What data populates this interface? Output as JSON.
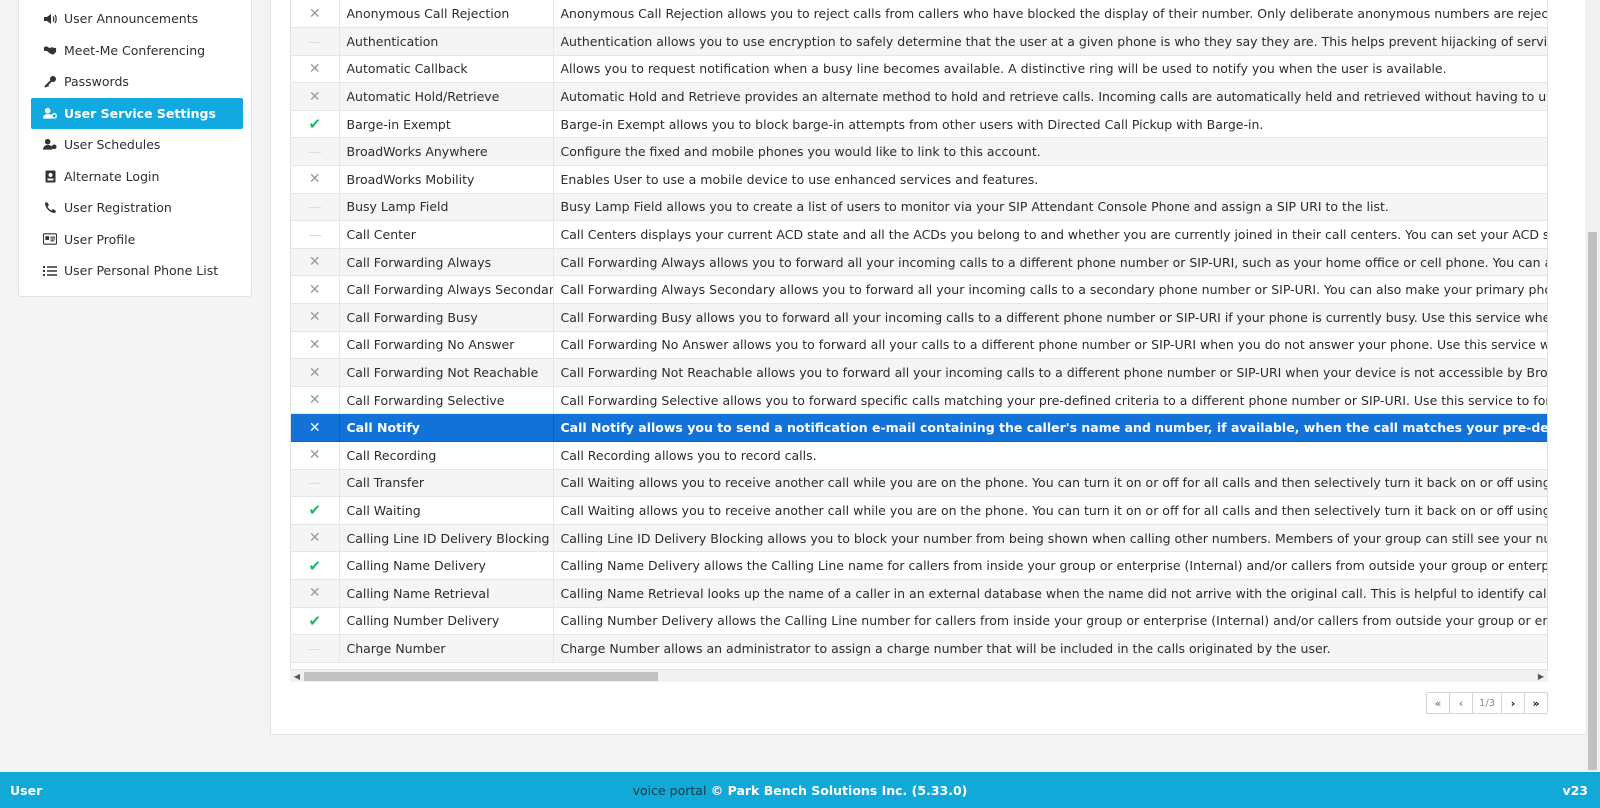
{
  "sidebar": {
    "items": [
      {
        "label": "User Announcements",
        "icon": "speaker-icon",
        "active": false
      },
      {
        "label": "Meet-Me Conferencing",
        "icon": "handshake-icon",
        "active": false
      },
      {
        "label": "Passwords",
        "icon": "key-icon",
        "active": false
      },
      {
        "label": "User Service Settings",
        "icon": "user-gear-icon",
        "active": true
      },
      {
        "label": "User Schedules",
        "icon": "user-clock-icon",
        "active": false
      },
      {
        "label": "Alternate Login",
        "icon": "id-badge-icon",
        "active": false
      },
      {
        "label": "User Registration",
        "icon": "phone-icon",
        "active": false
      },
      {
        "label": "User Profile",
        "icon": "id-card-icon",
        "active": false
      },
      {
        "label": "User Personal Phone List",
        "icon": "list-icon",
        "active": false
      }
    ]
  },
  "services": [
    {
      "status": "x",
      "name": "Anonymous Call Rejection",
      "description": "Anonymous Call Rejection allows you to reject calls from callers who have blocked the display of their number. Only deliberate anonymous numbers are rejected. Callers who"
    },
    {
      "status": "none",
      "name": "Authentication",
      "description": "Authentication allows you to use encryption to safely determine that the user at a given phone is who they say they are. This helps prevent hijacking of service in hosted con"
    },
    {
      "status": "x",
      "name": "Automatic Callback",
      "description": "Allows you to request notification when a busy line becomes available. A distinctive ring will be used to notify you when the user is available."
    },
    {
      "status": "x",
      "name": "Automatic Hold/Retrieve",
      "description": "Automatic Hold and Retrieve provides an alternate method to hold and retrieve calls. Incoming calls are automatically held and retrieved without having to use feature acc"
    },
    {
      "status": "check",
      "name": "Barge-in Exempt",
      "description": "Barge-in Exempt allows you to block barge-in attempts from other users with Directed Call Pickup with Barge-in."
    },
    {
      "status": "none",
      "name": "BroadWorks Anywhere",
      "description": "Configure the fixed and mobile phones you would like to link to this account."
    },
    {
      "status": "x",
      "name": "BroadWorks Mobility",
      "description": "Enables User to use a mobile device to use enhanced services and features."
    },
    {
      "status": "none",
      "name": "Busy Lamp Field",
      "description": "Busy Lamp Field allows you to create a list of users to monitor via your SIP Attendant Console Phone and assign a SIP URI to the list."
    },
    {
      "status": "none",
      "name": "Call Center",
      "description": "Call Centers displays your current ACD state and all the ACDs you belong to and whether you are currently joined in their call centers. You can set your ACD state and join o"
    },
    {
      "status": "x",
      "name": "Call Forwarding Always",
      "description": "Call Forwarding Always allows you to forward all your incoming calls to a different phone number or SIP-URI, such as your home office or cell phone. You can also make your p"
    },
    {
      "status": "x",
      "name": "Call Forwarding Always Secondary",
      "description": "Call Forwarding Always Secondary allows you to forward all your incoming calls to a secondary phone number or SIP-URI. You can also make your primary phone emit a sho"
    },
    {
      "status": "x",
      "name": "Call Forwarding Busy",
      "description": "Call Forwarding Busy allows you to forward all your incoming calls to a different phone number or SIP-URI if your phone is currently busy. Use this service when you would rath"
    },
    {
      "status": "x",
      "name": "Call Forwarding No Answer",
      "description": "Call Forwarding No Answer allows you to forward all your calls to a different phone number or SIP-URI when you do not answer your phone. Use this service when you would r"
    },
    {
      "status": "x",
      "name": "Call Forwarding Not Reachable",
      "description": "Call Forwarding Not Reachable allows you to forward all your incoming calls to a different phone number or SIP-URI when your device is not accessible by BroadWorks. Note"
    },
    {
      "status": "x",
      "name": "Call Forwarding Selective",
      "description": "Call Forwarding Selective allows you to forward specific calls matching your pre-defined criteria to a different phone number or SIP-URI. Use this service to forward calls from"
    },
    {
      "status": "x",
      "name": "Call Notify",
      "description": "Call Notify allows you to send a notification e-mail containing the caller's name and number, if available, when the call matches your pre-defined criteria. Use this to create",
      "selected": true
    },
    {
      "status": "x",
      "name": "Call Recording",
      "description": "Call Recording allows you to record calls."
    },
    {
      "status": "none",
      "name": "Call Transfer",
      "description": "Call Waiting allows you to receive another call while you are on the phone. You can turn it on or off for all calls and then selectively turn it back on or off using the feature acc"
    },
    {
      "status": "check",
      "name": "Call Waiting",
      "description": "Call Waiting allows you to receive another call while you are on the phone. You can turn it on or off for all calls and then selectively turn it back on or off using the feature acc"
    },
    {
      "status": "x",
      "name": "Calling Line ID Delivery Blocking",
      "description": "Calling Line ID Delivery Blocking allows you to block your number from being shown when calling other numbers. Members of your group can still see your number when they"
    },
    {
      "status": "check",
      "name": "Calling Name Delivery",
      "description": "Calling Name Delivery allows the Calling Line name for callers from inside your group or enterprise (Internal) and/or callers from outside your group or enterprise (External) to"
    },
    {
      "status": "x",
      "name": "Calling Name Retrieval",
      "description": "Calling Name Retrieval looks up the name of a caller in an external database when the name did not arrive with the original call. This is helpful to identify callers when using"
    },
    {
      "status": "check",
      "name": "Calling Number Delivery",
      "description": "Calling Number Delivery allows the Calling Line number for callers from inside your group or enterprise (Internal) and/or callers from outside your group or enterprise (External"
    },
    {
      "status": "none",
      "name": "Charge Number",
      "description": "Charge Number allows an administrator to assign a charge number that will be included in the calls originated by the user."
    }
  ],
  "pager": {
    "first": "«",
    "prev": "‹",
    "page": "1/3",
    "next": "›",
    "last": "»"
  },
  "footer": {
    "left": "User",
    "center_muted": "voice portal",
    "center": "© Park Bench Solutions Inc. (5.33.0)",
    "right": "v23"
  },
  "colors": {
    "accent": "#12a9d8",
    "selected_row": "#1272d8",
    "check": "#1fb86a"
  }
}
